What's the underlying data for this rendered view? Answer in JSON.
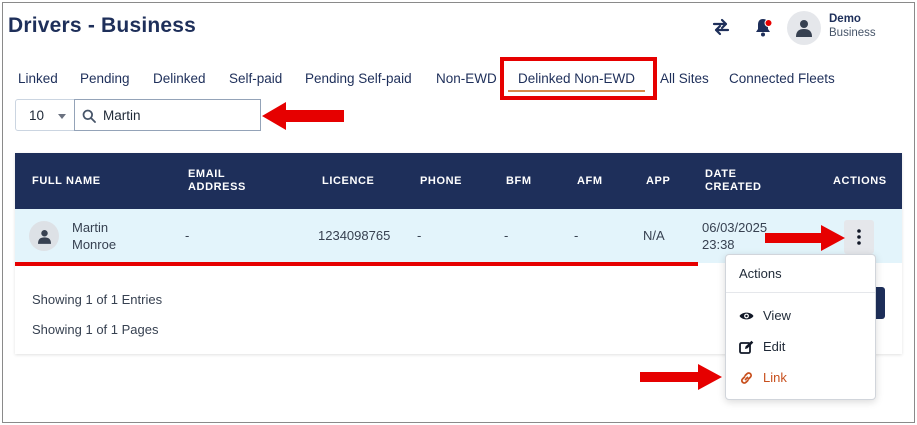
{
  "page": {
    "title": "Drivers - Business"
  },
  "user": {
    "name": "Demo",
    "role": "Business"
  },
  "tabs": [
    {
      "label": "Linked"
    },
    {
      "label": "Pending"
    },
    {
      "label": "Delinked"
    },
    {
      "label": "Self-paid"
    },
    {
      "label": "Pending Self-paid"
    },
    {
      "label": "Non-EWD"
    },
    {
      "label": "Delinked Non-EWD",
      "active": true
    },
    {
      "label": "All Sites"
    },
    {
      "label": "Connected Fleets"
    }
  ],
  "filters": {
    "page_size": "10",
    "search_value": "Martin"
  },
  "table": {
    "columns": [
      "FULL NAME",
      "EMAIL ADDRESS",
      "LICENCE",
      "PHONE",
      "BFM",
      "AFM",
      "APP",
      "DATE CREATED",
      "ACTIONS"
    ],
    "rows": [
      {
        "first_name": "Martin",
        "last_name": "Monroe",
        "email": "-",
        "licence": "1234098765",
        "phone": "-",
        "bfm": "-",
        "afm": "-",
        "app": "N/A",
        "date": "06/03/2025",
        "time": "23:38"
      }
    ]
  },
  "footer": {
    "entries": "Showing 1 of 1 Entries",
    "pages": "Showing 1 of 1 Pages"
  },
  "actions_menu": {
    "title": "Actions",
    "items": [
      {
        "label": "View",
        "icon": "eye-icon"
      },
      {
        "label": "Edit",
        "icon": "edit-icon"
      },
      {
        "label": "Link",
        "icon": "link-icon"
      }
    ]
  },
  "colors": {
    "navy": "#1e2f5a",
    "annotation_red": "#e60000",
    "row_highlight": "#e3f4fb",
    "link_orange": "#c8501e",
    "active_tab_underline": "#d6884a"
  }
}
